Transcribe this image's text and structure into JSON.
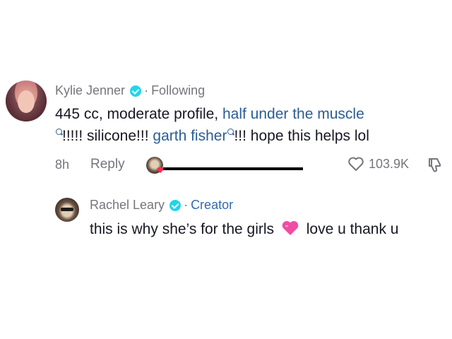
{
  "comment": {
    "username": "Kylie Jenner",
    "separator": "·",
    "status": "Following",
    "text_1": "445 cc, moderate profile, ",
    "link_1": "half under the muscle",
    "text_2": "!!!!! silicone!!! ",
    "link_2": "garth fisher",
    "text_3": "!!! hope this helps lol",
    "time": "8h",
    "reply_label": "Reply",
    "like_count": "103.9K"
  },
  "reply": {
    "username": "Rachel Leary",
    "separator": "·",
    "status": "Creator",
    "text_1": "this is why she’s for the girls ",
    "text_2": " love u thank u"
  },
  "icons": {
    "verified": "verified-badge-icon",
    "search": "search-icon",
    "like": "heart-outline-icon",
    "dislike": "thumbs-down-icon",
    "emoji": "pink-heart-emoji",
    "accent": "#20d5ec",
    "link_color": "#2b5d94",
    "emoji_color": "#f04ca4"
  }
}
